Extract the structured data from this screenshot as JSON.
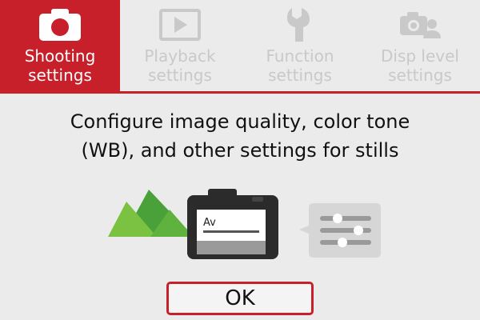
{
  "tabs": [
    {
      "label": "Shooting\nsettings",
      "icon": "camera-icon",
      "active": true
    },
    {
      "label": "Playback\nsettings",
      "icon": "playback-icon",
      "active": false
    },
    {
      "label": "Function\nsettings",
      "icon": "wrench-icon",
      "active": false
    },
    {
      "label": "Disp level\nsettings",
      "icon": "camera-user-icon",
      "active": false
    }
  ],
  "description": "Configure image quality, color tone\n(WB), and other settings for stills",
  "illustration": {
    "screen_mode": "Av"
  },
  "ok_label": "OK",
  "colors": {
    "accent": "#c8202a",
    "inactive": "#c9c9c9",
    "background": "#ebebeb",
    "mountain_light": "#7cc242",
    "mountain_dark": "#4aa13a",
    "camera_body": "#2b2b2b"
  }
}
